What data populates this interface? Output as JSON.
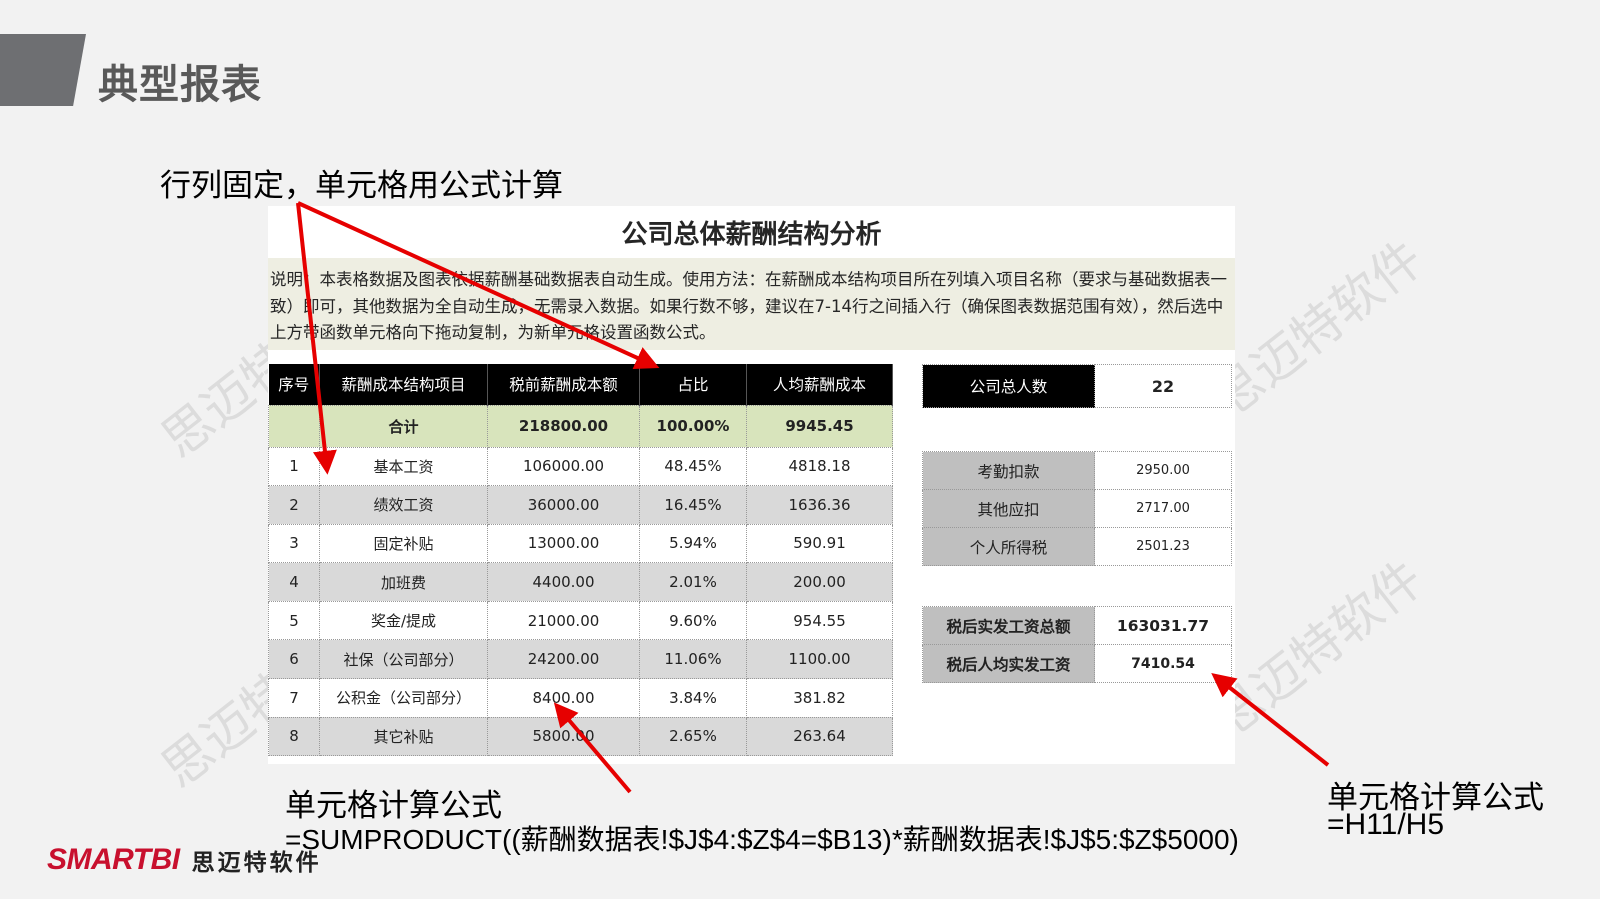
{
  "slide": {
    "title": "典型报表",
    "annotation_top": "行列固定，单元格用公式计算",
    "annotation_bottom_label": "单元格计算公式",
    "annotation_bottom_formula": "=SUMPRODUCT((薪酬数据表!$J$4:$Z$4=$B13)*薪酬数据表!$J$5:$Z$5000)",
    "annotation_right_label": "单元格计算公式",
    "annotation_right_formula": "=H11/H5",
    "watermark": "思迈特软件",
    "arrow_color": "#e60000"
  },
  "sheet": {
    "title": "公司总体薪酬结构分析",
    "note": "说明：本表格数据及图表依据薪酬基础数据表自动生成。使用方法：在薪酬成本结构项目所在列填入项目名称（要求与基础数据表一致）即可，其他数据为全自动生成，无需录入数据。如果行数不够，建议在7-14行之间插入行（确保图表数据范围有效），然后选中上方带函数单元格向下拖动复制，为新单元格设置函数公式。",
    "headers": [
      "序号",
      "薪酬成本结构项目",
      "税前薪酬成本额",
      "占比",
      "人均薪酬成本"
    ],
    "total": {
      "label": "合计",
      "amount": "218800.00",
      "ratio": "100.00%",
      "per_capita": "9945.45"
    },
    "rows": [
      {
        "no": "1",
        "item": "基本工资",
        "amount": "106000.00",
        "ratio": "48.45%",
        "per_capita": "4818.18"
      },
      {
        "no": "2",
        "item": "绩效工资",
        "amount": "36000.00",
        "ratio": "16.45%",
        "per_capita": "1636.36"
      },
      {
        "no": "3",
        "item": "固定补贴",
        "amount": "13000.00",
        "ratio": "5.94%",
        "per_capita": "590.91"
      },
      {
        "no": "4",
        "item": "加班费",
        "amount": "4400.00",
        "ratio": "2.01%",
        "per_capita": "200.00"
      },
      {
        "no": "5",
        "item": "奖金/提成",
        "amount": "21000.00",
        "ratio": "9.60%",
        "per_capita": "954.55"
      },
      {
        "no": "6",
        "item": "社保（公司部分）",
        "amount": "24200.00",
        "ratio": "11.06%",
        "per_capita": "1100.00"
      },
      {
        "no": "7",
        "item": "公积金（公司部分）",
        "amount": "8400.00",
        "ratio": "3.84%",
        "per_capita": "381.82"
      },
      {
        "no": "8",
        "item": "其它补贴",
        "amount": "5800.00",
        "ratio": "2.65%",
        "per_capita": "263.64"
      }
    ],
    "headcount": {
      "label": "公司总人数",
      "value": "22"
    },
    "deductions": [
      {
        "label": "考勤扣款",
        "value": "2950.00"
      },
      {
        "label": "其他应扣",
        "value": "2717.00"
      },
      {
        "label": "个人所得税",
        "value": "2501.23"
      }
    ],
    "net": [
      {
        "label": "税后实发工资总额",
        "value": "163031.77"
      },
      {
        "label": "税后人均实发工资",
        "value": "7410.54"
      }
    ]
  },
  "logo": {
    "brand": "SMARTBI",
    "cn": "思迈特软件",
    "brand_color": "#c8102e"
  }
}
